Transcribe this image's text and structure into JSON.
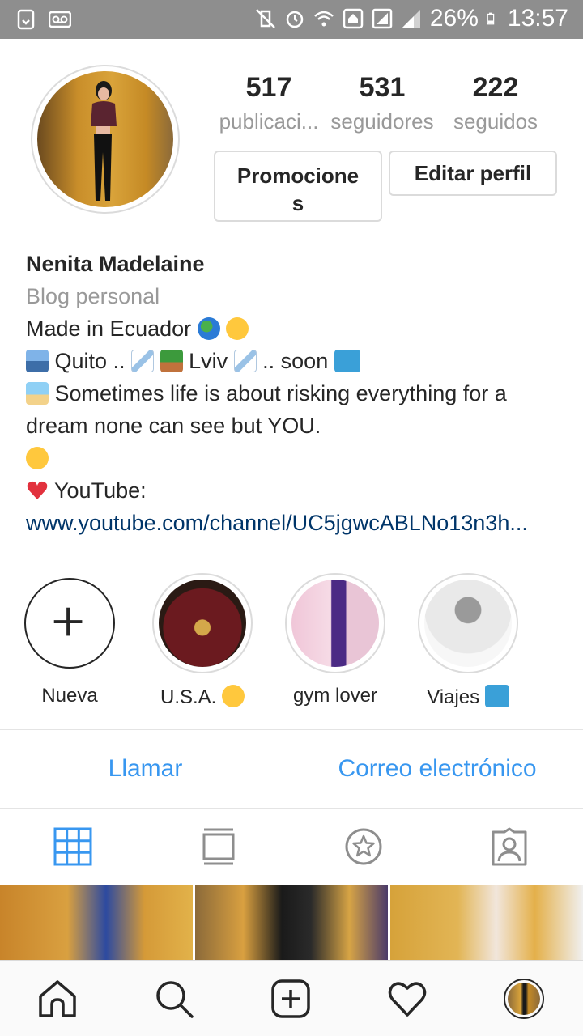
{
  "status_bar": {
    "battery": "26%",
    "time": "13:57"
  },
  "profile": {
    "stats": [
      {
        "value": "517",
        "label": "publicaci..."
      },
      {
        "value": "531",
        "label": "seguidores"
      },
      {
        "value": "222",
        "label": "seguidos"
      }
    ],
    "promote_line1": "Promocione",
    "promote_line2": "s",
    "edit_label": "Editar perfil"
  },
  "bio": {
    "name": "Nenita Madelaine",
    "category": "Blog personal",
    "line1": "Made in Ecuador",
    "line2_a": "Quito ..",
    "line2_b": "Lviv",
    "line2_c": ".. soon",
    "line3": "Sometimes life is about risking everything for a dream none can see but YOU.",
    "line5": "YouTube:",
    "link": "www.youtube.com/channel/UC5jgwcABLNo13n3h..."
  },
  "highlights": [
    {
      "label": "Nueva"
    },
    {
      "label": "U.S.A."
    },
    {
      "label": "gym lover"
    },
    {
      "label": "Viajes"
    }
  ],
  "contact": {
    "call": "Llamar",
    "email": "Correo electrónico"
  },
  "colors": {
    "accent": "#3897f0",
    "link": "#003569",
    "muted": "#999999",
    "status_bar": "#8e8e8e"
  },
  "icons": {
    "tabs": [
      "grid-icon",
      "feed-icon",
      "saved-star-icon",
      "tagged-person-icon"
    ],
    "nav": [
      "home-icon",
      "search-icon",
      "add-post-icon",
      "heart-icon",
      "profile-avatar-icon"
    ]
  }
}
